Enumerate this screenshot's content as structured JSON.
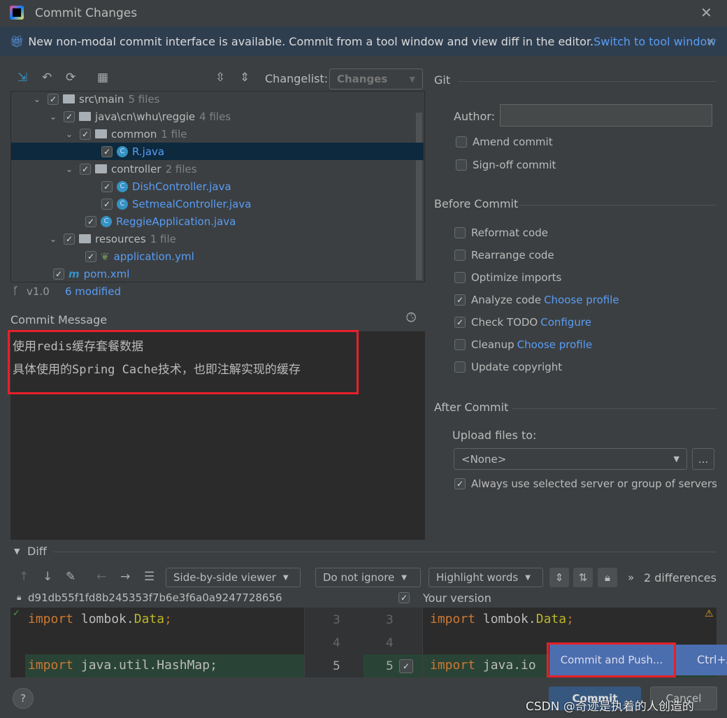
{
  "window": {
    "title": "Commit Changes"
  },
  "banner": {
    "text": "New non-modal commit interface is available. Commit from a tool window and view diff in the editor.",
    "link": "Switch to tool window"
  },
  "toolbar": {
    "changelist_label": "Changelist:",
    "changelist_value": "Changes"
  },
  "tree": [
    {
      "name": "src\\main",
      "count": "5 files",
      "type": "folder",
      "depth": 0
    },
    {
      "name": "java\\cn\\whu\\reggie",
      "count": "4 files",
      "type": "folder",
      "depth": 1
    },
    {
      "name": "common",
      "count": "1 file",
      "type": "folder",
      "depth": 2
    },
    {
      "name": "R.java",
      "count": "",
      "type": "class",
      "depth": 3,
      "selected": true
    },
    {
      "name": "controller",
      "count": "2 files",
      "type": "folder",
      "depth": 2
    },
    {
      "name": "DishController.java",
      "count": "",
      "type": "class",
      "depth": 3
    },
    {
      "name": "SetmealController.java",
      "count": "",
      "type": "class",
      "depth": 3
    },
    {
      "name": "ReggieApplication.java",
      "count": "",
      "type": "app",
      "depth": 2
    },
    {
      "name": "resources",
      "count": "1 file",
      "type": "folder",
      "depth": 1
    },
    {
      "name": "application.yml",
      "count": "",
      "type": "yml",
      "depth": 2
    },
    {
      "name": "pom.xml",
      "count": "",
      "type": "maven",
      "depth": 0
    }
  ],
  "status": {
    "branch": "v1.0",
    "modified": "6 modified"
  },
  "commit_message": {
    "label": "Commit Message",
    "lines": [
      "使用redis缓存套餐数据",
      "具体使用的Spring Cache技术，也即注解实现的缓存"
    ]
  },
  "git": {
    "title": "Git",
    "author_label": "Author:",
    "author_value": "",
    "amend": "Amend commit",
    "signoff": "Sign-off commit"
  },
  "before_commit": {
    "title": "Before Commit",
    "options": [
      {
        "label": "Reformat code",
        "checked": false,
        "link": ""
      },
      {
        "label": "Rearrange code",
        "checked": false,
        "link": ""
      },
      {
        "label": "Optimize imports",
        "checked": false,
        "link": ""
      },
      {
        "label": "Analyze code",
        "checked": true,
        "link": "Choose profile"
      },
      {
        "label": "Check TODO",
        "checked": true,
        "link": "Configure"
      },
      {
        "label": "Cleanup",
        "checked": false,
        "link": "Choose profile"
      },
      {
        "label": "Update copyright",
        "checked": false,
        "link": ""
      }
    ]
  },
  "after_commit": {
    "title": "After Commit",
    "upload_label": "Upload files to:",
    "upload_value": "<None>",
    "browse": "...",
    "always": "Always use selected server or group of servers"
  },
  "diff": {
    "title": "Diff",
    "viewer": "Side-by-side viewer",
    "ignore": "Do not ignore",
    "highlight": "Highlight words",
    "differences": "2 differences",
    "left_rev": "d91db55f1fd8b245353f7b6e3f6a0a9247728656",
    "right_rev": "Your version",
    "left_lines": [
      {
        "kw": "import",
        "rest": " lombok.",
        "ty": "Data",
        ";": ";"
      },
      {
        "kw": "",
        "rest": ""
      },
      {
        "kw": "import",
        "rest": " java.util.HashMap;"
      }
    ],
    "right_lines": [
      {
        "kw": "import",
        "rest": " lombok.",
        "ty": "Data"
      },
      {
        "kw": "",
        "rest": ""
      },
      {
        "kw": "import",
        "rest": " java.io"
      }
    ],
    "line_numbers": [
      "3",
      "4",
      "5"
    ]
  },
  "popup": {
    "item": "Commit and Push...",
    "shortcut": "Ctrl+A"
  },
  "buttons": {
    "help": "?",
    "commit": "Commit",
    "cancel": "Cancel"
  },
  "watermark": "CSDN @奇迹是执着的人创造的"
}
